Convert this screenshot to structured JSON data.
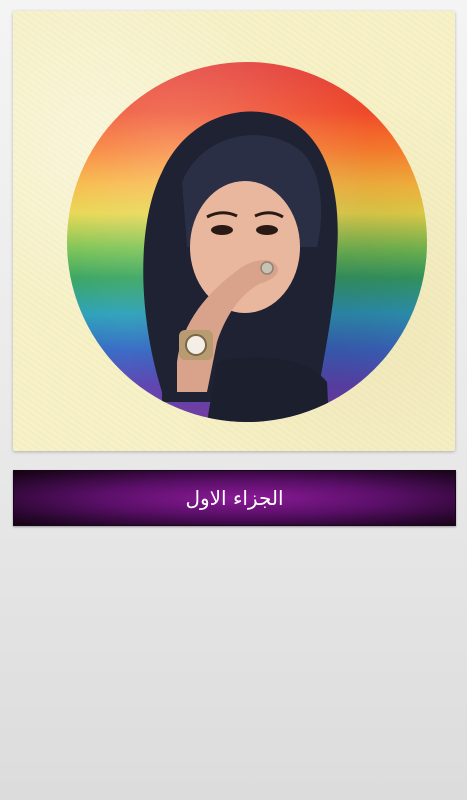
{
  "cover": {
    "image_desc": "cover-image",
    "background_color": "#f6f0c4"
  },
  "chapters": [
    {
      "label": "الجزاء الاول"
    }
  ],
  "colors": {
    "banner_center": "#8a1a97",
    "banner_edge": "#14030f",
    "banner_text": "#ffffff",
    "page_background": "#e6e6e6"
  }
}
